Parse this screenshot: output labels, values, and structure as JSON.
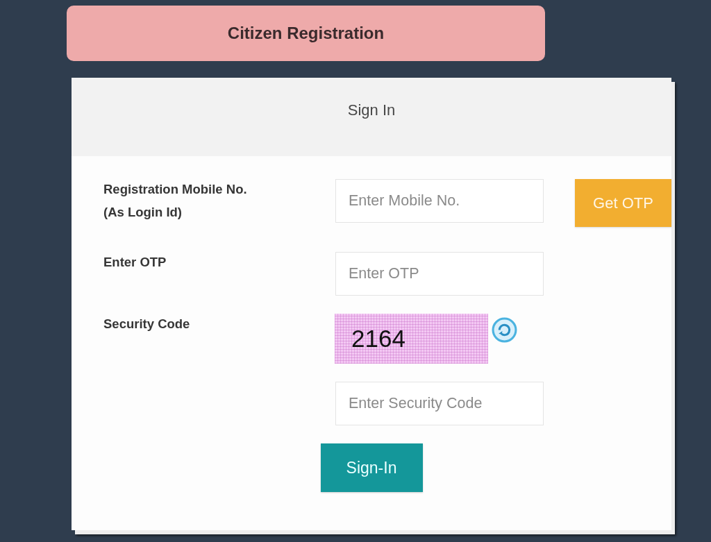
{
  "header": {
    "title": "Citizen Registration"
  },
  "card": {
    "title": "Sign In"
  },
  "form": {
    "rows": [
      {
        "kind": "input",
        "label": "Registration Mobile No.\n(As Login Id)",
        "placeholder": "Enter Mobile No.",
        "action": {
          "label": "Get OTP"
        }
      },
      {
        "kind": "input",
        "label": "Enter OTP",
        "placeholder": "Enter OTP"
      },
      {
        "kind": "captcha",
        "label": "Security Code",
        "code": "2164"
      },
      {
        "kind": "input",
        "placeholder": "Enter Security Code"
      }
    ],
    "submit": {
      "label": "Sign-In"
    }
  }
}
